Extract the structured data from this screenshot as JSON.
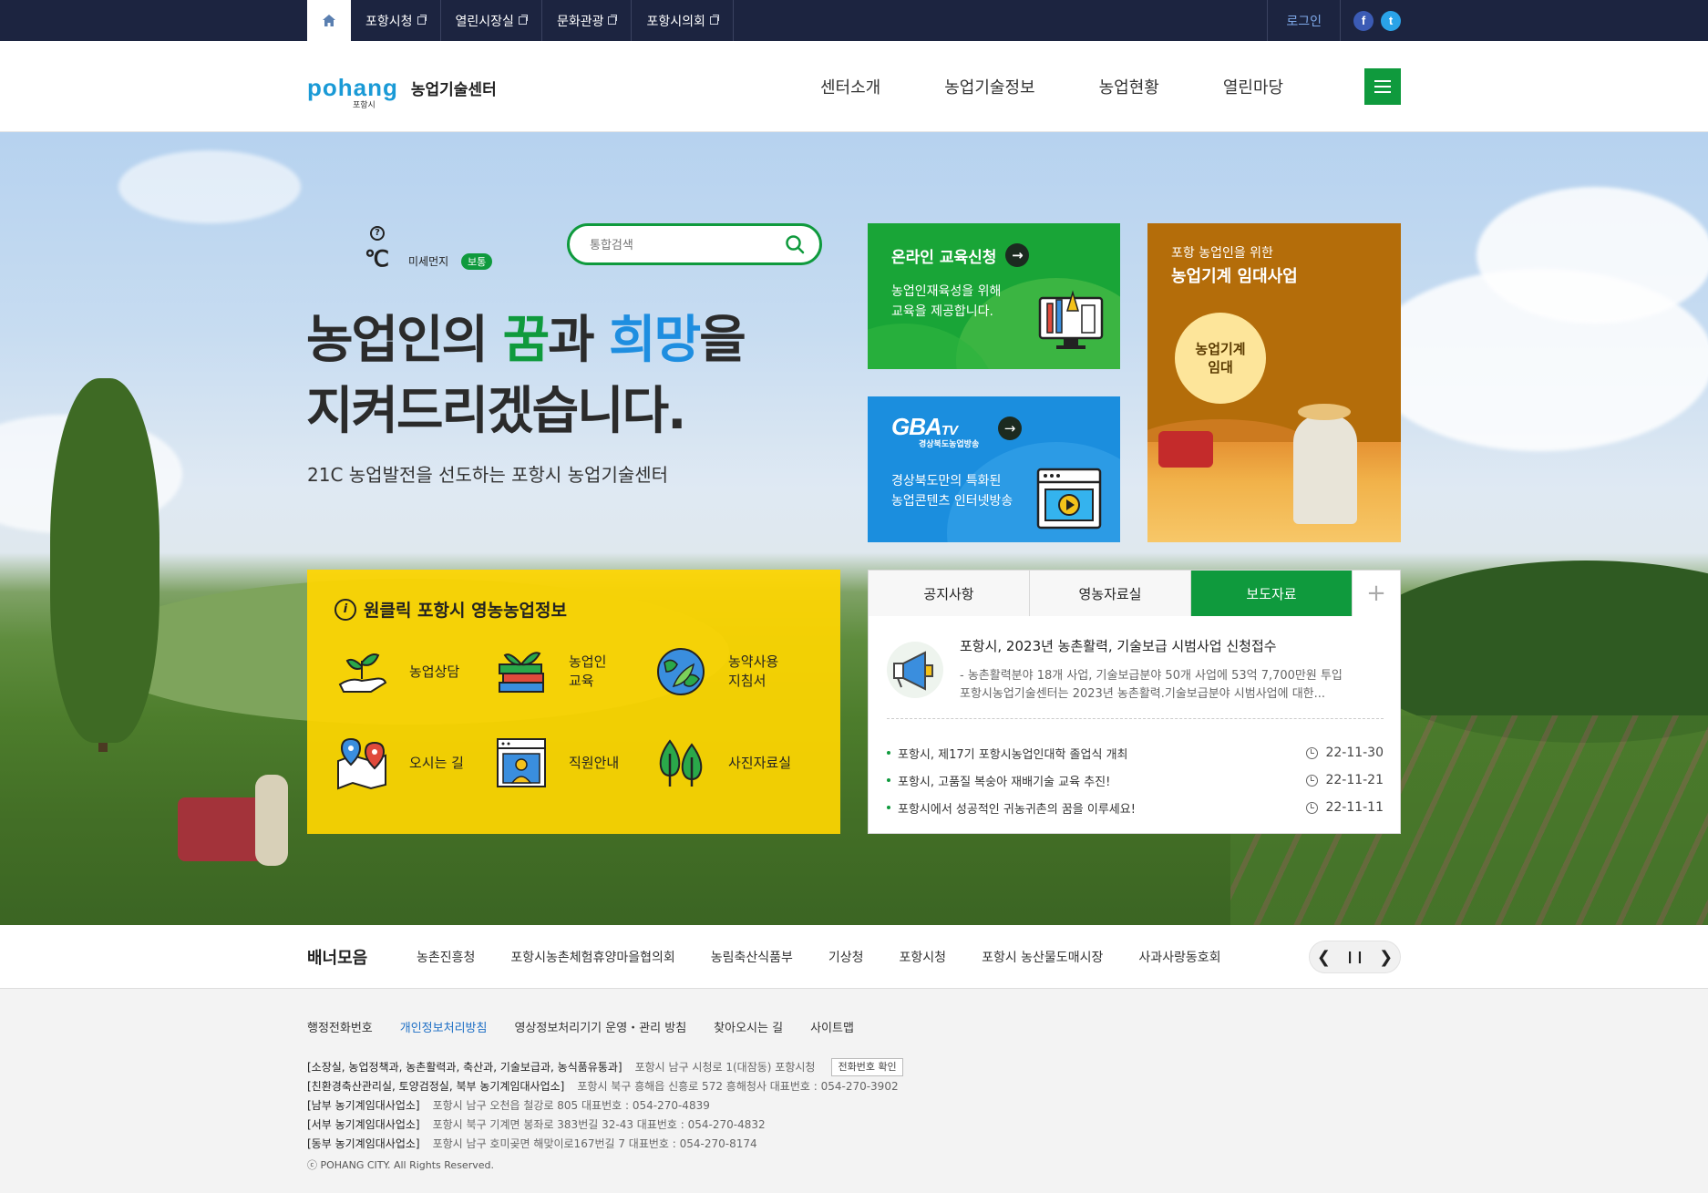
{
  "topbar": {
    "home_icon": "home-icon",
    "links": [
      "포항시청",
      "열린시장실",
      "문화관광",
      "포항시의회"
    ],
    "login": "로그인",
    "sns": [
      {
        "name": "facebook-icon",
        "glyph": "f"
      },
      {
        "name": "twitter-icon",
        "glyph": "t"
      }
    ]
  },
  "header": {
    "logo_word": "pohang",
    "logo_sub": "포항시",
    "logo_name": "농업기술센터",
    "nav": [
      "센터소개",
      "농업기술정보",
      "농업현황",
      "열린마당"
    ],
    "menu_icon": "hamburger-menu-icon"
  },
  "hero": {
    "weather": {
      "help": "?",
      "temp_unit": "℃",
      "dust_label": "미세먼지",
      "dust_status": "보통"
    },
    "search": {
      "placeholder": "통합검색",
      "icon": "search-icon"
    },
    "slogan": {
      "line1_a": "농업인의 ",
      "line1_green": "꿈",
      "line1_b": "과 ",
      "line1_blue": "희망",
      "line1_c": "을",
      "line2": "지켜드리겠습니다."
    },
    "sub_slogan": "21C 농업발전을 선도하는 포항시 농업기술센터"
  },
  "cards": {
    "edu": {
      "title": "온라인 교육신청",
      "desc_line1": "농업인재육성을 위해",
      "desc_line2": "교육을 제공합니다.",
      "icon": "education-monitor-icon"
    },
    "tv": {
      "logo": "GBA",
      "logo_tv": "TV",
      "logo_sub": "경상북도농업방송",
      "desc_line1": "경상북도만의 특화된",
      "desc_line2": "농업콘텐츠 인터넷방송",
      "icon": "video-player-icon"
    },
    "machine": {
      "sub": "포항 농업인을 위한",
      "title": "농업기계 임대사업",
      "circle_line1": "농업기계",
      "circle_line2": "임대"
    }
  },
  "oneclick": {
    "title": "원클릭 포항시 영농농업정보",
    "info_glyph": "i",
    "items": [
      {
        "icon": "plant-hand-icon",
        "line1": "농업상담",
        "line2": ""
      },
      {
        "icon": "books-plant-icon",
        "line1": "농업인",
        "line2": "교육"
      },
      {
        "icon": "earth-leaf-icon",
        "line1": "농약사용",
        "line2": "지침서"
      },
      {
        "icon": "map-pin-icon",
        "line1": "오시는 길",
        "line2": ""
      },
      {
        "icon": "staff-profile-icon",
        "line1": "직원안내",
        "line2": ""
      },
      {
        "icon": "trees-icon",
        "line1": "사진자료실",
        "line2": ""
      }
    ]
  },
  "news": {
    "tabs": [
      "공지사항",
      "영농자료실",
      "보도자료"
    ],
    "active_tab": "보도자료",
    "plus": "+",
    "feature": {
      "title": "포항시, 2023년 농촌활력, 기술보급 시범사업 신청접수",
      "desc_line1": "- 농촌활력분야 18개 사업, 기술보급분야 50개 사업에 53억 7,700만원 투입",
      "desc_line2": "포항시농업기술센터는 2023년 농촌활력.기술보급분야 시범사업에 대한..."
    },
    "items": [
      {
        "title": "포항시, 제17기 포항시농업인대학 졸업식 개최",
        "date": "22-11-30"
      },
      {
        "title": "포항시, 고품질 복숭아 재배기술 교육 추진!",
        "date": "22-11-21"
      },
      {
        "title": "포항시에서 성공적인 귀농귀촌의 꿈을 이루세요!",
        "date": "22-11-11"
      }
    ]
  },
  "banner": {
    "title": "배너모음",
    "links": [
      "농촌진흥청",
      "포항시농촌체험휴양마을협의회",
      "농림축산식품부",
      "기상청",
      "포항시청",
      "포항시 농산물도매시장",
      "사과사랑동호회"
    ],
    "prev": "❮",
    "pause": "❙❙",
    "next": "❯"
  },
  "footer": {
    "links": [
      "행정전화번호",
      "개인정보처리방침",
      "영상정보처리기기 운영・관리 방침",
      "찾아오시는 길",
      "사이트맵"
    ],
    "highlight_link": "개인정보처리방침",
    "addresses": [
      {
        "org": "[소장실, 농업정책과, 농촌활력과, 축산과, 기술보급과, 농식품유통과]",
        "loc": "포항시 남구 시청로 1(대잠동) 포항시청",
        "button": "전화번호 확인"
      },
      {
        "org": "[친환경축산관리실, 토양검정실, 북부 농기계임대사업소]",
        "loc": "포항시 북구 흥해읍 신흥로 572 흥해청사 대표번호 : 054-270-3902",
        "button": ""
      },
      {
        "org": "[남부 농기계임대사업소]",
        "loc": "포항시 남구 오천읍 철강로 805 대표번호 : 054-270-4839",
        "button": ""
      },
      {
        "org": "[서부 농기계임대사업소]",
        "loc": "포항시 북구 기계면 봉좌로 383번길 32-43 대표번호 : 054-270-4832",
        "button": ""
      },
      {
        "org": "[동부 농기계임대사업소]",
        "loc": "포항시 남구 호미곶면 해맞이로167번길 7 대표번호 : 054-270-8174",
        "button": ""
      }
    ],
    "copyright": "ⓒ POHANG CITY. All Rights Reserved."
  },
  "colors": {
    "navy": "#1c2440",
    "green": "#0f9a3d",
    "blue": "#1e8ee0",
    "yellow": "#ffd600",
    "brown": "#b46d0a"
  }
}
